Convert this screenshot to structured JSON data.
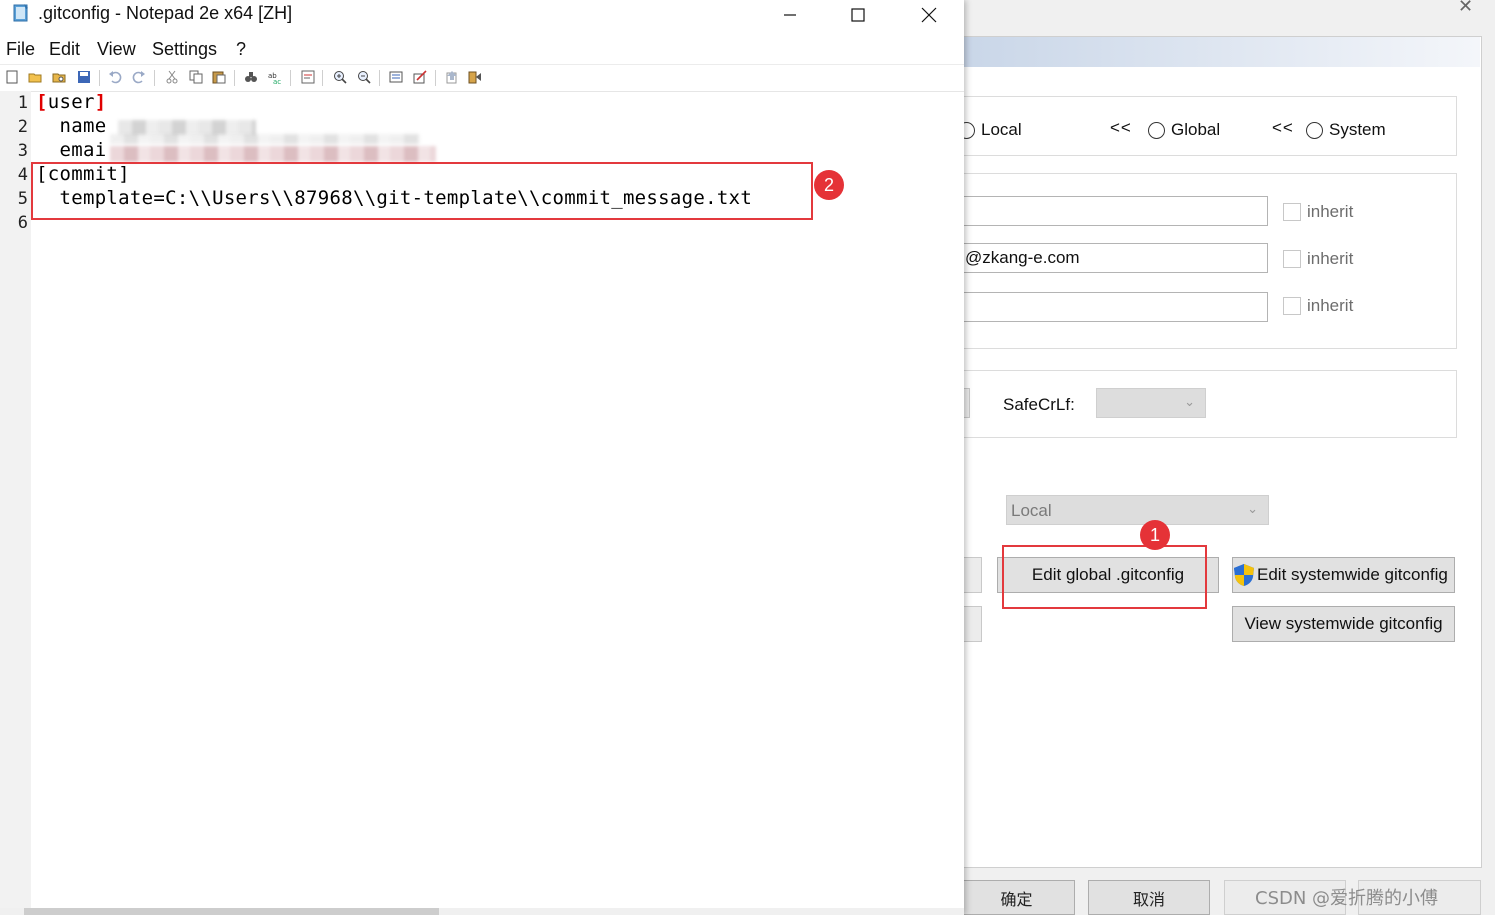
{
  "notepad": {
    "title": ".gitconfig - Notepad 2e x64 [ZH]",
    "menu": [
      "File",
      "Edit",
      "View",
      "Settings",
      "?"
    ],
    "line_numbers": [
      "1",
      "2",
      "3",
      "4",
      "5",
      "6"
    ],
    "lines": {
      "l1": "user",
      "l2": "  name",
      "l3": "  emai",
      "l4": "[commit]",
      "l5": "  template=C:\\\\Users\\\\87968\\\\git-template\\\\commit_message.txt",
      "l6": ""
    }
  },
  "settings": {
    "scope_radios": [
      "Local",
      "Global",
      "System"
    ],
    "scope_arrows": "<<",
    "email_value": "@zkang-e.com",
    "inherit_label": "inherit",
    "safecrlf_label": "SafeCrLf:",
    "config_source": "Local",
    "buttons": {
      "edit_global": "Edit global .gitconfig",
      "edit_system": "Edit systemwide gitconfig",
      "view_system": "View systemwide gitconfig"
    },
    "bottom": {
      "ok": "确定",
      "cancel": "取消"
    }
  },
  "annotations": {
    "badge1": "1",
    "badge2": "2"
  },
  "watermark": "CSDN @爱折腾的小傅",
  "colors": {
    "annotation_red": "#e3393d",
    "bracket_red": "#e00000"
  }
}
